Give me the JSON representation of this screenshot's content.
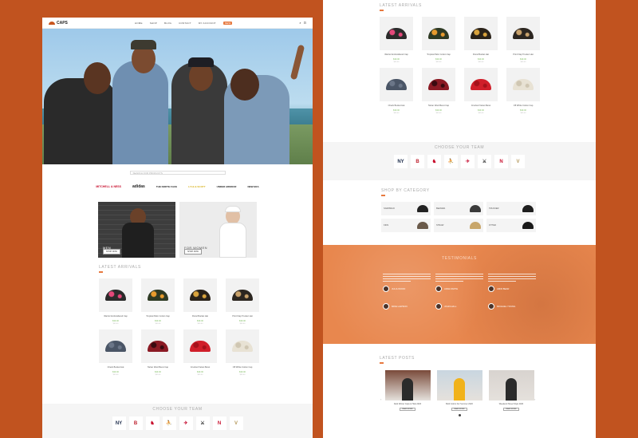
{
  "brand": {
    "name": "CAPS"
  },
  "nav": {
    "items": [
      "HOME",
      "SHOP",
      "BLOG",
      "CONTACT",
      "MY ACCOUNT"
    ],
    "badge": "NEW"
  },
  "header_icons": {
    "search": "search-icon",
    "cart": "cart-icon"
  },
  "search": {
    "placeholder": "SEARCH FOR PRODUCTS"
  },
  "brands": [
    "MITCHELL & NESS",
    "adidas",
    "THE NORTH FACE",
    "LYLE & SCOTT",
    "UNDER ARMOUR",
    "NEW ERA"
  ],
  "promos": {
    "men": {
      "label": "MEN",
      "button": "SHOP NOW"
    },
    "women": {
      "label": "FOR WOMEN",
      "button": "SHOP NOW"
    }
  },
  "latest": {
    "title": "LATEST ARRIVALS",
    "products": [
      {
        "name": "Warrior Embroidered Cap",
        "price": "$39.00",
        "old": "$45.00",
        "color": "#2b2b2b",
        "accent": "#e4487a"
      },
      {
        "name": "Tropical Palm Cotton Cap",
        "price": "$39.00",
        "old": "$45.00",
        "color": "#2e3a24",
        "accent": "#e79b2e"
      },
      {
        "name": "Floral Bucket Hat",
        "price": "$39.00",
        "old": "$45.00",
        "color": "#2a2219",
        "accent": "#d9a33c"
      },
      {
        "name": "Print Flap Trucker Hat",
        "price": "$39.00",
        "old": "$45.00",
        "color": "#2c2620",
        "accent": "#c9a26b"
      },
      {
        "name": "Check Bucket Hat",
        "price": "$39.00",
        "old": "$45.00",
        "color": "#4a5566",
        "accent": "#6b7688"
      },
      {
        "name": "Tartan Wool Beret Cap",
        "price": "$39.00",
        "old": "$45.00",
        "color": "#8b1a24",
        "accent": "#3a0a10"
      },
      {
        "name": "Crushed Velvet Beret",
        "price": "$39.00",
        "old": "$45.00",
        "color": "#d01f2a",
        "accent": "#a5121b"
      },
      {
        "name": "Off White Cotton Cap",
        "price": "$39.00",
        "old": "$45.00",
        "color": "#e8e2d4",
        "accent": "#cfc6b2"
      }
    ]
  },
  "teams": {
    "title": "CHOOSE YOUR TEAM",
    "items": [
      {
        "label": "NY",
        "color": "#1c2b4a"
      },
      {
        "label": "B",
        "color": "#bd1e2c"
      },
      {
        "label": "♞",
        "color": "#c8102e"
      },
      {
        "label": "⛹",
        "color": "#552583"
      },
      {
        "label": "✈",
        "color": "#c60c30"
      },
      {
        "label": "⚔",
        "color": "#222222"
      },
      {
        "label": "N",
        "color": "#c8102e"
      },
      {
        "label": "V",
        "color": "#b4975a"
      }
    ]
  },
  "categories": {
    "title": "SHOP BY CATEGORY",
    "items": [
      {
        "label": "SNAPBACK",
        "color": "#222222"
      },
      {
        "label": "BEANIES",
        "color": "#3a3a3a"
      },
      {
        "label": "TRUCKER",
        "color": "#1e1e1e"
      },
      {
        "label": "KIDS",
        "color": "#6a5a4a"
      },
      {
        "label": "STRAW",
        "color": "#c8a66a"
      },
      {
        "label": "FITTED",
        "color": "#1a1a1a"
      }
    ]
  },
  "testimonials": {
    "title": "TESTIMONIALS",
    "items": [
      {
        "name": "JULIA WOOD"
      },
      {
        "name": "ANNA SMITH"
      },
      {
        "name": "AMIR BEAR"
      },
      {
        "name": "MIKE LAWSON"
      },
      {
        "name": "JOHN HALL"
      },
      {
        "name": "MICHAEL YOUNG"
      }
    ]
  },
  "blog": {
    "title": "LATEST POSTS",
    "posts": [
      {
        "title": "Dark Winter Caps & Hats 2020",
        "button": "READ MORE",
        "bg": "#7a4a3a"
      },
      {
        "title": "Bold Colors For Summer 2020",
        "button": "READ MORE",
        "bg": "#c9d6e0"
      },
      {
        "title": "Weekend Street Style 2020",
        "button": "READ MORE",
        "bg": "#d8d3cf"
      }
    ]
  },
  "colors": {
    "accent": "#e7793f",
    "background": "#c1531f",
    "price": "#86c06b"
  }
}
